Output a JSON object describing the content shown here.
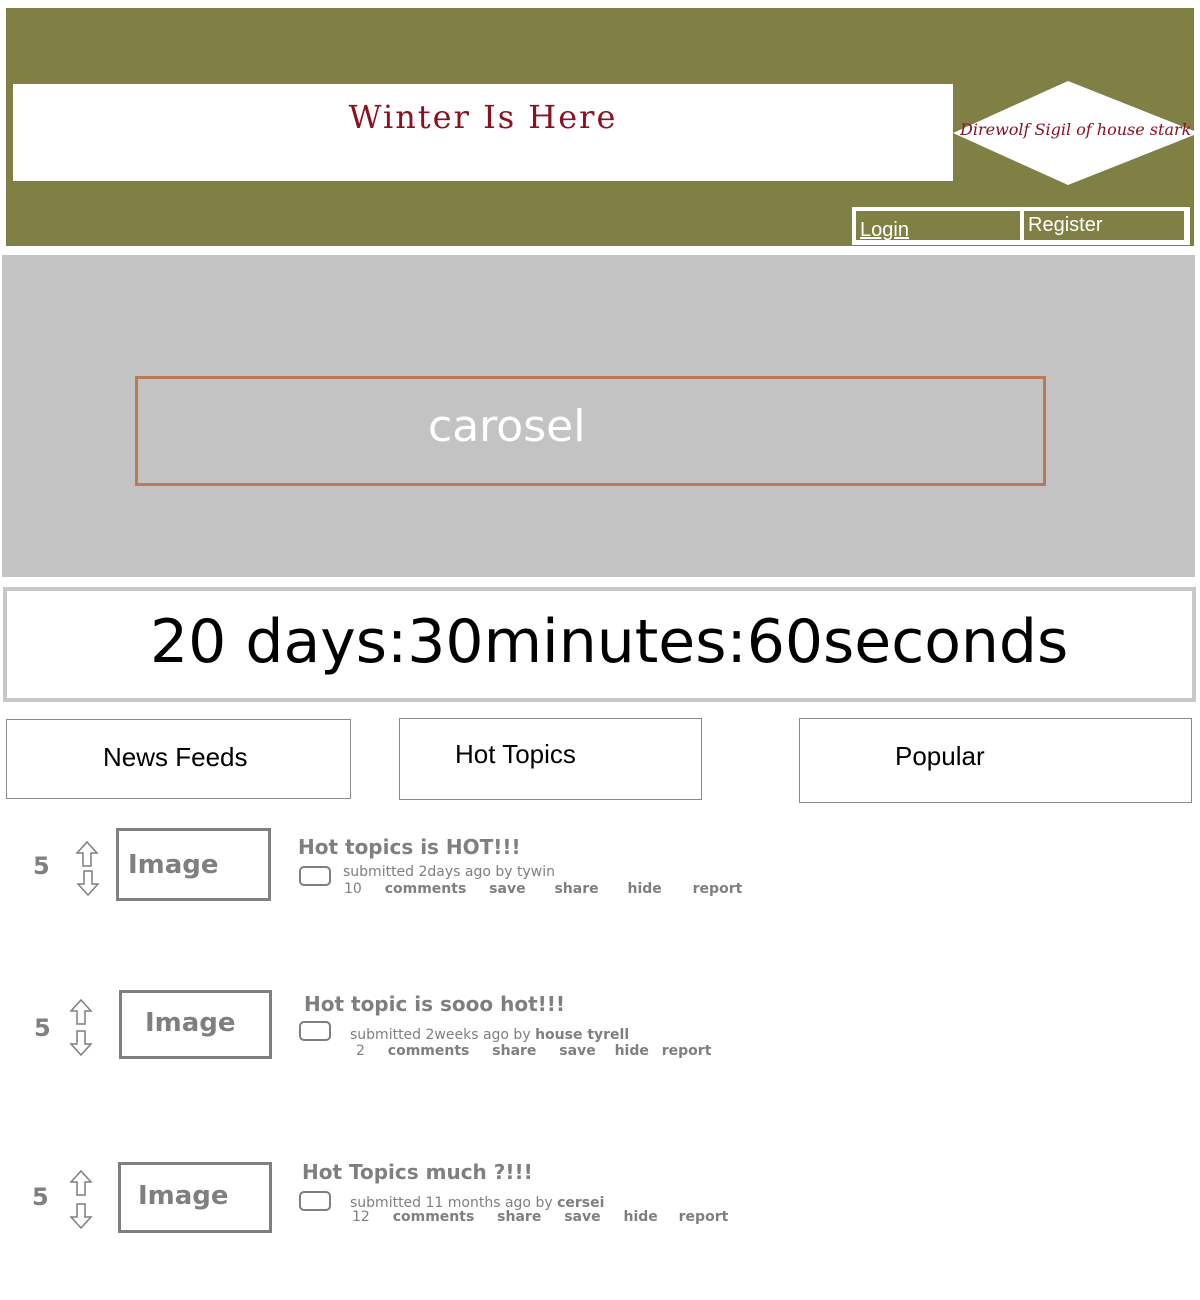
{
  "header": {
    "site_title": "Winter Is Here",
    "sigil_text": "Direwolf Sigil of house stark",
    "login_label": "Login",
    "register_label": "Register"
  },
  "carousel": {
    "label": "carosel"
  },
  "countdown": {
    "text": "20 days:30minutes:60seconds"
  },
  "tabs": [
    {
      "label": "News Feeds"
    },
    {
      "label": "Hot Topics"
    },
    {
      "label": "Popular"
    }
  ],
  "posts": [
    {
      "score": "5",
      "image_label": "Image",
      "title": "Hot topics is HOT!!!",
      "submitted_prefix": "submitted 2days ago by ",
      "author": "tywin",
      "comments_count": "10",
      "comments_label": "comments",
      "actions": [
        "save",
        "share",
        "hide",
        "report"
      ]
    },
    {
      "score": "5",
      "image_label": "Image",
      "title": "Hot topic is sooo hot!!!",
      "submitted_prefix": "submitted 2weeks ago by ",
      "author": "house tyrell",
      "comments_count": "2",
      "comments_label": "comments",
      "actions": [
        "share",
        "save",
        "hide",
        "report"
      ]
    },
    {
      "score": "5",
      "image_label": "Image",
      "title": "Hot Topics much ?!!!",
      "submitted_prefix": "submitted 11 months ago by ",
      "author": "cersei",
      "comments_count": "12",
      "comments_label": "comments",
      "actions": [
        "share",
        "save",
        "hide",
        "report"
      ]
    }
  ],
  "colors": {
    "header_bg": "#818044",
    "title_red": "#8b1020",
    "carousel_bg": "#c3c3c3",
    "carousel_border": "#b97a57",
    "post_gray": "#7f7f7f"
  }
}
